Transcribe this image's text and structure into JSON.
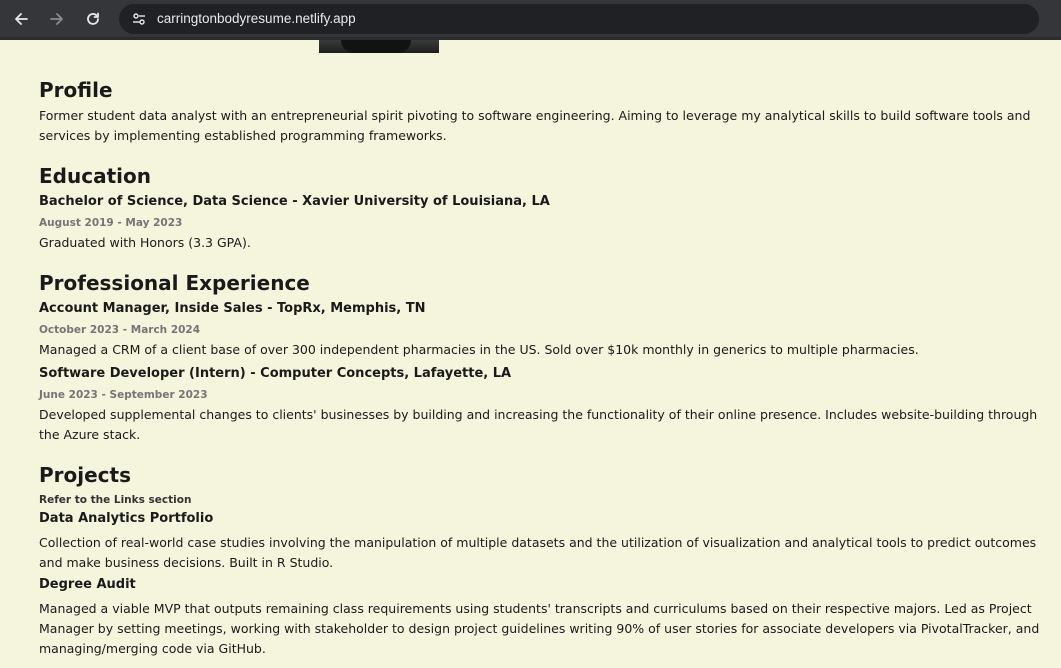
{
  "browser": {
    "url": "carringtonbodyresume.netlify.app"
  },
  "profile": {
    "heading": "Profile",
    "text": "Former student data analyst with an entrepreneurial spirit pivoting to software engineering. Aiming to leverage my analytical skills to build software tools and services by implementing established programming frameworks."
  },
  "education": {
    "heading": "Education",
    "items": [
      {
        "title": "Bachelor of Science, Data Science - Xavier University of Louisiana, LA",
        "dates": "August 2019 - May 2023",
        "description": "Graduated with Honors (3.3 GPA)."
      }
    ]
  },
  "experience": {
    "heading": "Professional Experience",
    "items": [
      {
        "title": "Account Manager, Inside Sales - TopRx, Memphis, TN",
        "dates": "October 2023 - March 2024",
        "description": "Managed a CRM of a client base of over 300 independent pharmacies in the US. Sold over $10k monthly in generics to multiple pharmacies."
      },
      {
        "title": "Software Developer (Intern) - Computer Concepts, Lafayette, LA",
        "dates": "June 2023 - September 2023",
        "description": "Developed supplemental changes to clients' businesses by building and increasing the functionality of their online presence. Includes website-building through the Azure stack."
      }
    ]
  },
  "projects": {
    "heading": "Projects",
    "note": "Refer to the Links section",
    "items": [
      {
        "title": "Data Analytics Portfolio",
        "description": "Collection of real-world case studies involving the manipulation of multiple datasets and the utilization of visualization and analytical tools to predict outcomes and make business decisions. Built in R Studio."
      },
      {
        "title": "Degree Audit",
        "description": "Managed a viable MVP that outputs remaining class requirements using students' transcripts and curriculums based on their respective majors. Led as Project Manager by setting meetings, working with stakeholder to design project guidelines writing 90% of user stories for associate developers via PivotalTracker, and managing/merging code via GitHub."
      }
    ]
  }
}
